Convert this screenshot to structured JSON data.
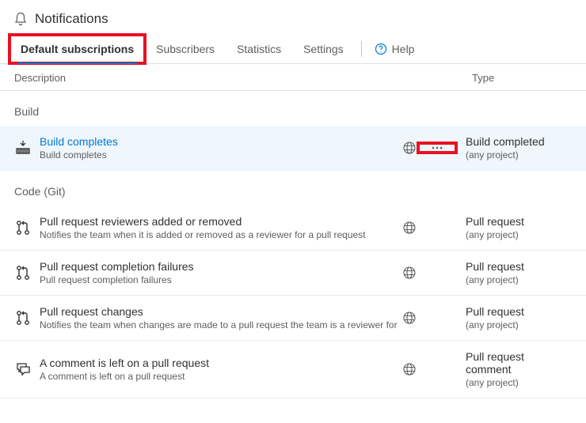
{
  "header": {
    "title": "Notifications"
  },
  "tabs": {
    "default_subscriptions": "Default subscriptions",
    "subscribers": "Subscribers",
    "statistics": "Statistics",
    "settings": "Settings",
    "help": "Help"
  },
  "columns": {
    "description": "Description",
    "type": "Type"
  },
  "groups": {
    "build": {
      "label": "Build"
    },
    "code_git": {
      "label": "Code (Git)"
    }
  },
  "rows": {
    "build_completes": {
      "title": "Build completes",
      "sub": "Build completes",
      "type_title": "Build completed",
      "type_sub": "(any project)"
    },
    "pr_reviewers": {
      "title": "Pull request reviewers added or removed",
      "sub": "Notifies the team when it is added or removed as a reviewer for a pull request",
      "type_title": "Pull request",
      "type_sub": "(any project)"
    },
    "pr_completion_failures": {
      "title": "Pull request completion failures",
      "sub": "Pull request completion failures",
      "type_title": "Pull request",
      "type_sub": "(any project)"
    },
    "pr_changes": {
      "title": "Pull request changes",
      "sub": "Notifies the team when changes are made to a pull request the team is a reviewer for",
      "type_title": "Pull request",
      "type_sub": "(any project)"
    },
    "pr_comment": {
      "title": "A comment is left on a pull request",
      "sub": "A comment is left on a pull request",
      "type_title": "Pull request comment",
      "type_sub": "(any project)"
    }
  }
}
